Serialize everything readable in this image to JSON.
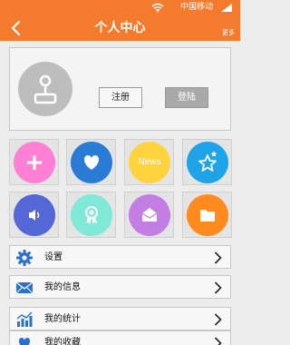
{
  "status_bar": {
    "carrier": "中国移动"
  },
  "nav": {
    "title": "个人中心",
    "more_label": "更多"
  },
  "profile": {
    "register_label": "注册",
    "login_label": "登陆"
  },
  "grid": {
    "items": [
      {
        "name": "add",
        "color": "#ff80d4"
      },
      {
        "name": "favorite",
        "color": "#2a7bd6"
      },
      {
        "name": "news",
        "color": "#ffd33d",
        "text": "News"
      },
      {
        "name": "star",
        "color": "#1fa3e8"
      },
      {
        "name": "volume",
        "color": "#5566d6"
      },
      {
        "name": "badge",
        "color": "#7fe8d6"
      },
      {
        "name": "mail",
        "color": "#c27ee3"
      },
      {
        "name": "folder",
        "color": "#ff8a1e"
      }
    ]
  },
  "menu": {
    "items": [
      {
        "label": "设置",
        "icon": "gear-icon"
      },
      {
        "label": "我的信息",
        "icon": "envelope-icon"
      },
      {
        "label": "我的统计",
        "icon": "bar-chart-icon"
      },
      {
        "label": "我的收藏",
        "icon": "heart-icon"
      }
    ]
  },
  "colors": {
    "accent": "#f47a2e",
    "icon_blue": "#2a73c8"
  }
}
